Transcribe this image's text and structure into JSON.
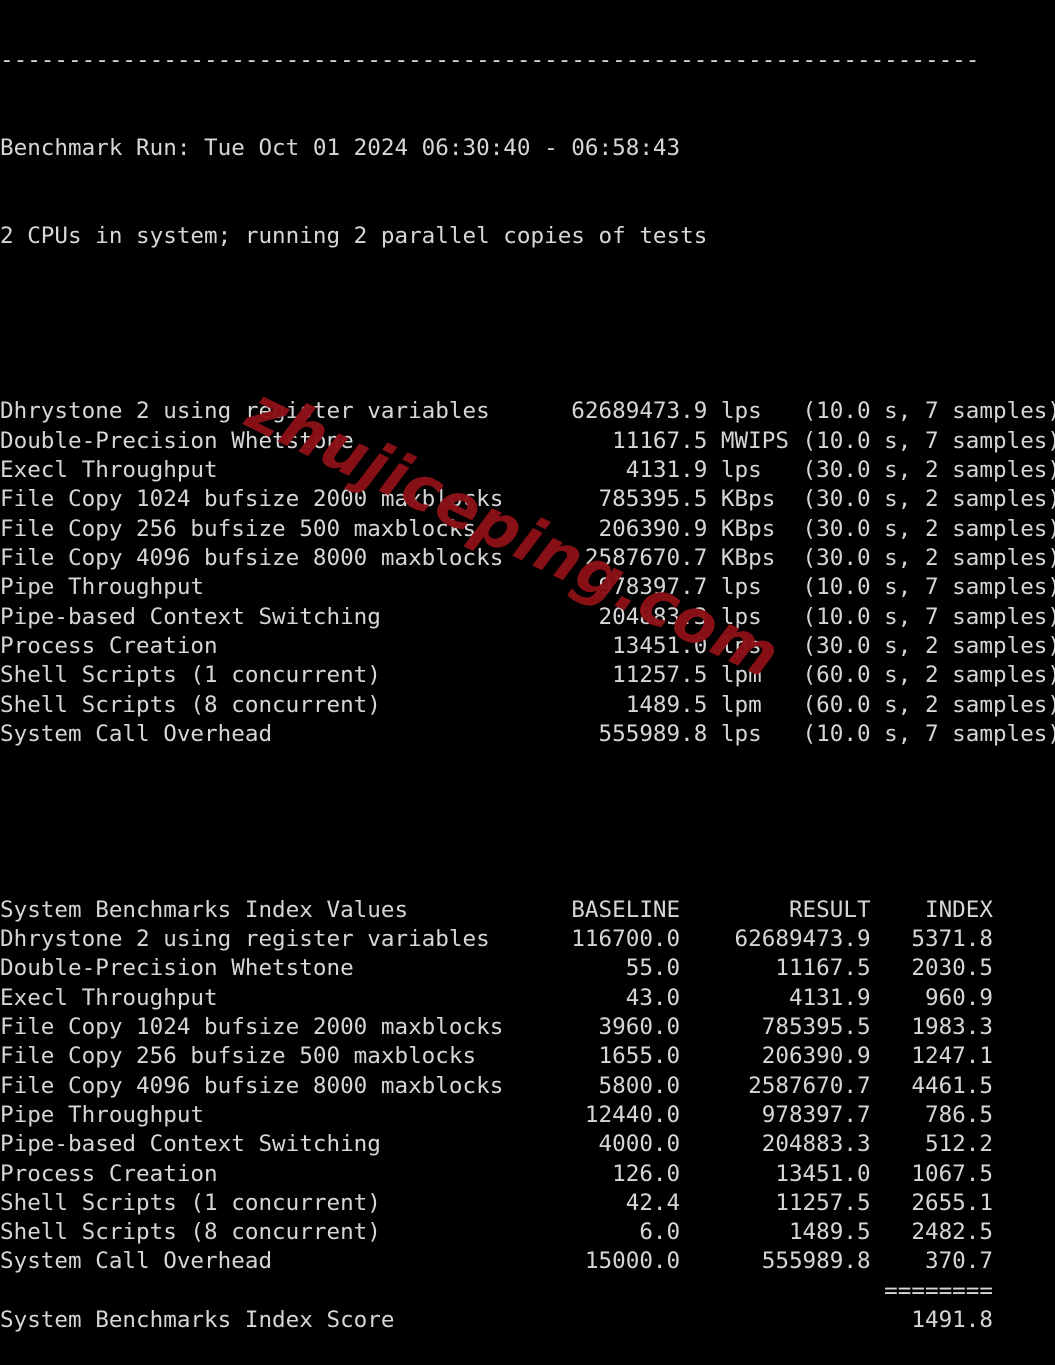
{
  "terminal": {
    "background_color": "#000000",
    "text_color": "#d6d6d6",
    "rule_top": "------------------------------------------------------------------------",
    "benchmark_run_line": "Benchmark Run: Tue Oct 01 2024 06:30:40 - 06:58:43",
    "cpu_line": "2 CPUs in system; running 2 parallel copies of tests",
    "blank": ""
  },
  "watermark": {
    "text": "zhujiceping.com",
    "color": "#8c1118"
  },
  "raw_results": {
    "rows": [
      {
        "name": "Dhrystone 2 using register variables",
        "value": "62689473.9",
        "unit": "lps",
        "samples": "(10.0 s, 7 samples)"
      },
      {
        "name": "Double-Precision Whetstone",
        "value": "11167.5",
        "unit": "MWIPS",
        "samples": "(10.0 s, 7 samples)"
      },
      {
        "name": "Execl Throughput",
        "value": "4131.9",
        "unit": "lps",
        "samples": "(30.0 s, 2 samples)"
      },
      {
        "name": "File Copy 1024 bufsize 2000 maxblocks",
        "value": "785395.5",
        "unit": "KBps",
        "samples": "(30.0 s, 2 samples)"
      },
      {
        "name": "File Copy 256 bufsize 500 maxblocks",
        "value": "206390.9",
        "unit": "KBps",
        "samples": "(30.0 s, 2 samples)"
      },
      {
        "name": "File Copy 4096 bufsize 8000 maxblocks",
        "value": "2587670.7",
        "unit": "KBps",
        "samples": "(30.0 s, 2 samples)"
      },
      {
        "name": "Pipe Throughput",
        "value": "978397.7",
        "unit": "lps",
        "samples": "(10.0 s, 7 samples)"
      },
      {
        "name": "Pipe-based Context Switching",
        "value": "204883.3",
        "unit": "lps",
        "samples": "(10.0 s, 7 samples)"
      },
      {
        "name": "Process Creation",
        "value": "13451.0",
        "unit": "lps",
        "samples": "(30.0 s, 2 samples)"
      },
      {
        "name": "Shell Scripts (1 concurrent)",
        "value": "11257.5",
        "unit": "lpm",
        "samples": "(60.0 s, 2 samples)"
      },
      {
        "name": "Shell Scripts (8 concurrent)",
        "value": "1489.5",
        "unit": "lpm",
        "samples": "(60.0 s, 2 samples)"
      },
      {
        "name": "System Call Overhead",
        "value": "555989.8",
        "unit": "lps",
        "samples": "(10.0 s, 7 samples)"
      }
    ]
  },
  "index_table": {
    "title": "System Benchmarks Index Values",
    "headers": {
      "baseline": "BASELINE",
      "result": "RESULT",
      "index": "INDEX"
    },
    "rows": [
      {
        "name": "Dhrystone 2 using register variables",
        "baseline": "116700.0",
        "result": "62689473.9",
        "index": "5371.8"
      },
      {
        "name": "Double-Precision Whetstone",
        "baseline": "55.0",
        "result": "11167.5",
        "index": "2030.5"
      },
      {
        "name": "Execl Throughput",
        "baseline": "43.0",
        "result": "4131.9",
        "index": "960.9"
      },
      {
        "name": "File Copy 1024 bufsize 2000 maxblocks",
        "baseline": "3960.0",
        "result": "785395.5",
        "index": "1983.3"
      },
      {
        "name": "File Copy 256 bufsize 500 maxblocks",
        "baseline": "1655.0",
        "result": "206390.9",
        "index": "1247.1"
      },
      {
        "name": "File Copy 4096 bufsize 8000 maxblocks",
        "baseline": "5800.0",
        "result": "2587670.7",
        "index": "4461.5"
      },
      {
        "name": "Pipe Throughput",
        "baseline": "12440.0",
        "result": "978397.7",
        "index": "786.5"
      },
      {
        "name": "Pipe-based Context Switching",
        "baseline": "4000.0",
        "result": "204883.3",
        "index": "512.2"
      },
      {
        "name": "Process Creation",
        "baseline": "126.0",
        "result": "13451.0",
        "index": "1067.5"
      },
      {
        "name": "Shell Scripts (1 concurrent)",
        "baseline": "42.4",
        "result": "11257.5",
        "index": "2655.1"
      },
      {
        "name": "Shell Scripts (8 concurrent)",
        "baseline": "6.0",
        "result": "1489.5",
        "index": "2482.5"
      },
      {
        "name": "System Call Overhead",
        "baseline": "15000.0",
        "result": "555989.8",
        "index": "370.7"
      }
    ],
    "separator": "========",
    "score_label": "System Benchmarks Index Score",
    "score_value": "1491.8"
  }
}
